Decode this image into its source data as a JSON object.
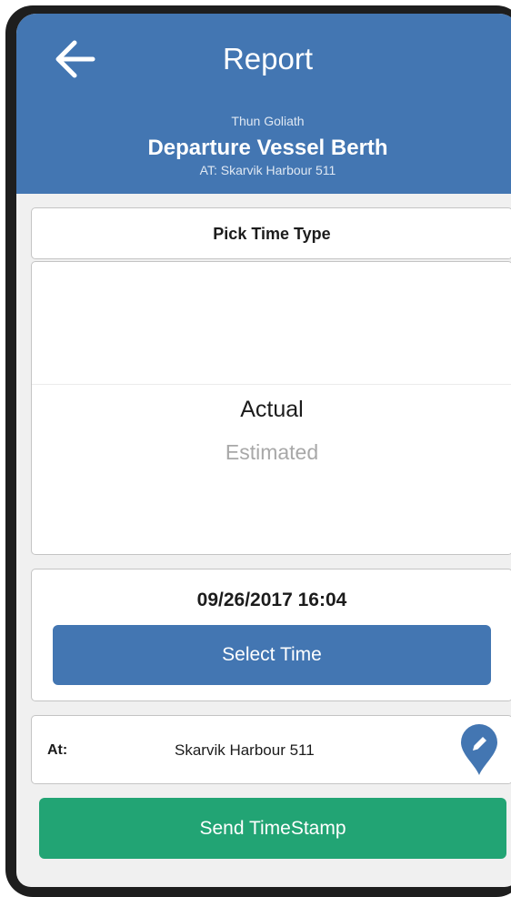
{
  "header": {
    "title": "Report",
    "vessel": "Thun Goliath",
    "event": "Departure Vessel Berth",
    "location_line": "AT: Skarvik Harbour 511",
    "back_icon": "arrow-left-icon"
  },
  "time_type": {
    "title": "Pick Time Type",
    "options": [
      "Actual",
      "Estimated"
    ],
    "selected": "Actual"
  },
  "time": {
    "value": "09/26/2017 16:04",
    "select_label": "Select Time"
  },
  "location": {
    "label": "At:",
    "value": "Skarvik Harbour 511",
    "edit_icon": "location-pin-edit-icon"
  },
  "actions": {
    "send_label": "Send TimeStamp"
  },
  "colors": {
    "header": "#4376b2",
    "primary_button": "#4376b2",
    "send_button": "#22a474"
  }
}
